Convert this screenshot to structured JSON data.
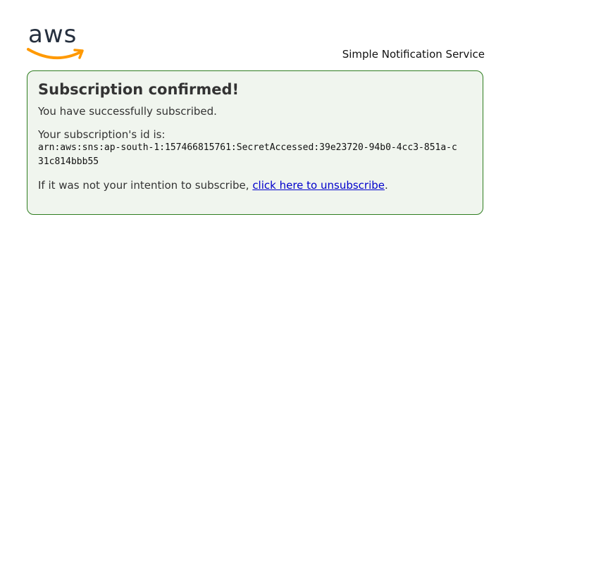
{
  "header": {
    "logo_name": "aws-logo",
    "service_name": "Simple Notification Service"
  },
  "panel": {
    "title": "Subscription confirmed!",
    "success_text": "You have successfully subscribed.",
    "id_label": "Your subscription's id is:",
    "subscription_arn": "arn:aws:sns:ap-south-1:157466815761:SecretAccessed:39e23720-94b0-4cc3-851a-c31c814bbb55",
    "unsubscribe_prefix": "If it was not your intention to subscribe, ",
    "unsubscribe_link": "click here to unsubscribe",
    "unsubscribe_suffix": "."
  },
  "colors": {
    "panel_border": "#2e7d1f",
    "panel_background": "#f0f5ee",
    "logo_text": "#252f3e",
    "logo_smile": "#ff9900",
    "link": "#0000cc"
  }
}
